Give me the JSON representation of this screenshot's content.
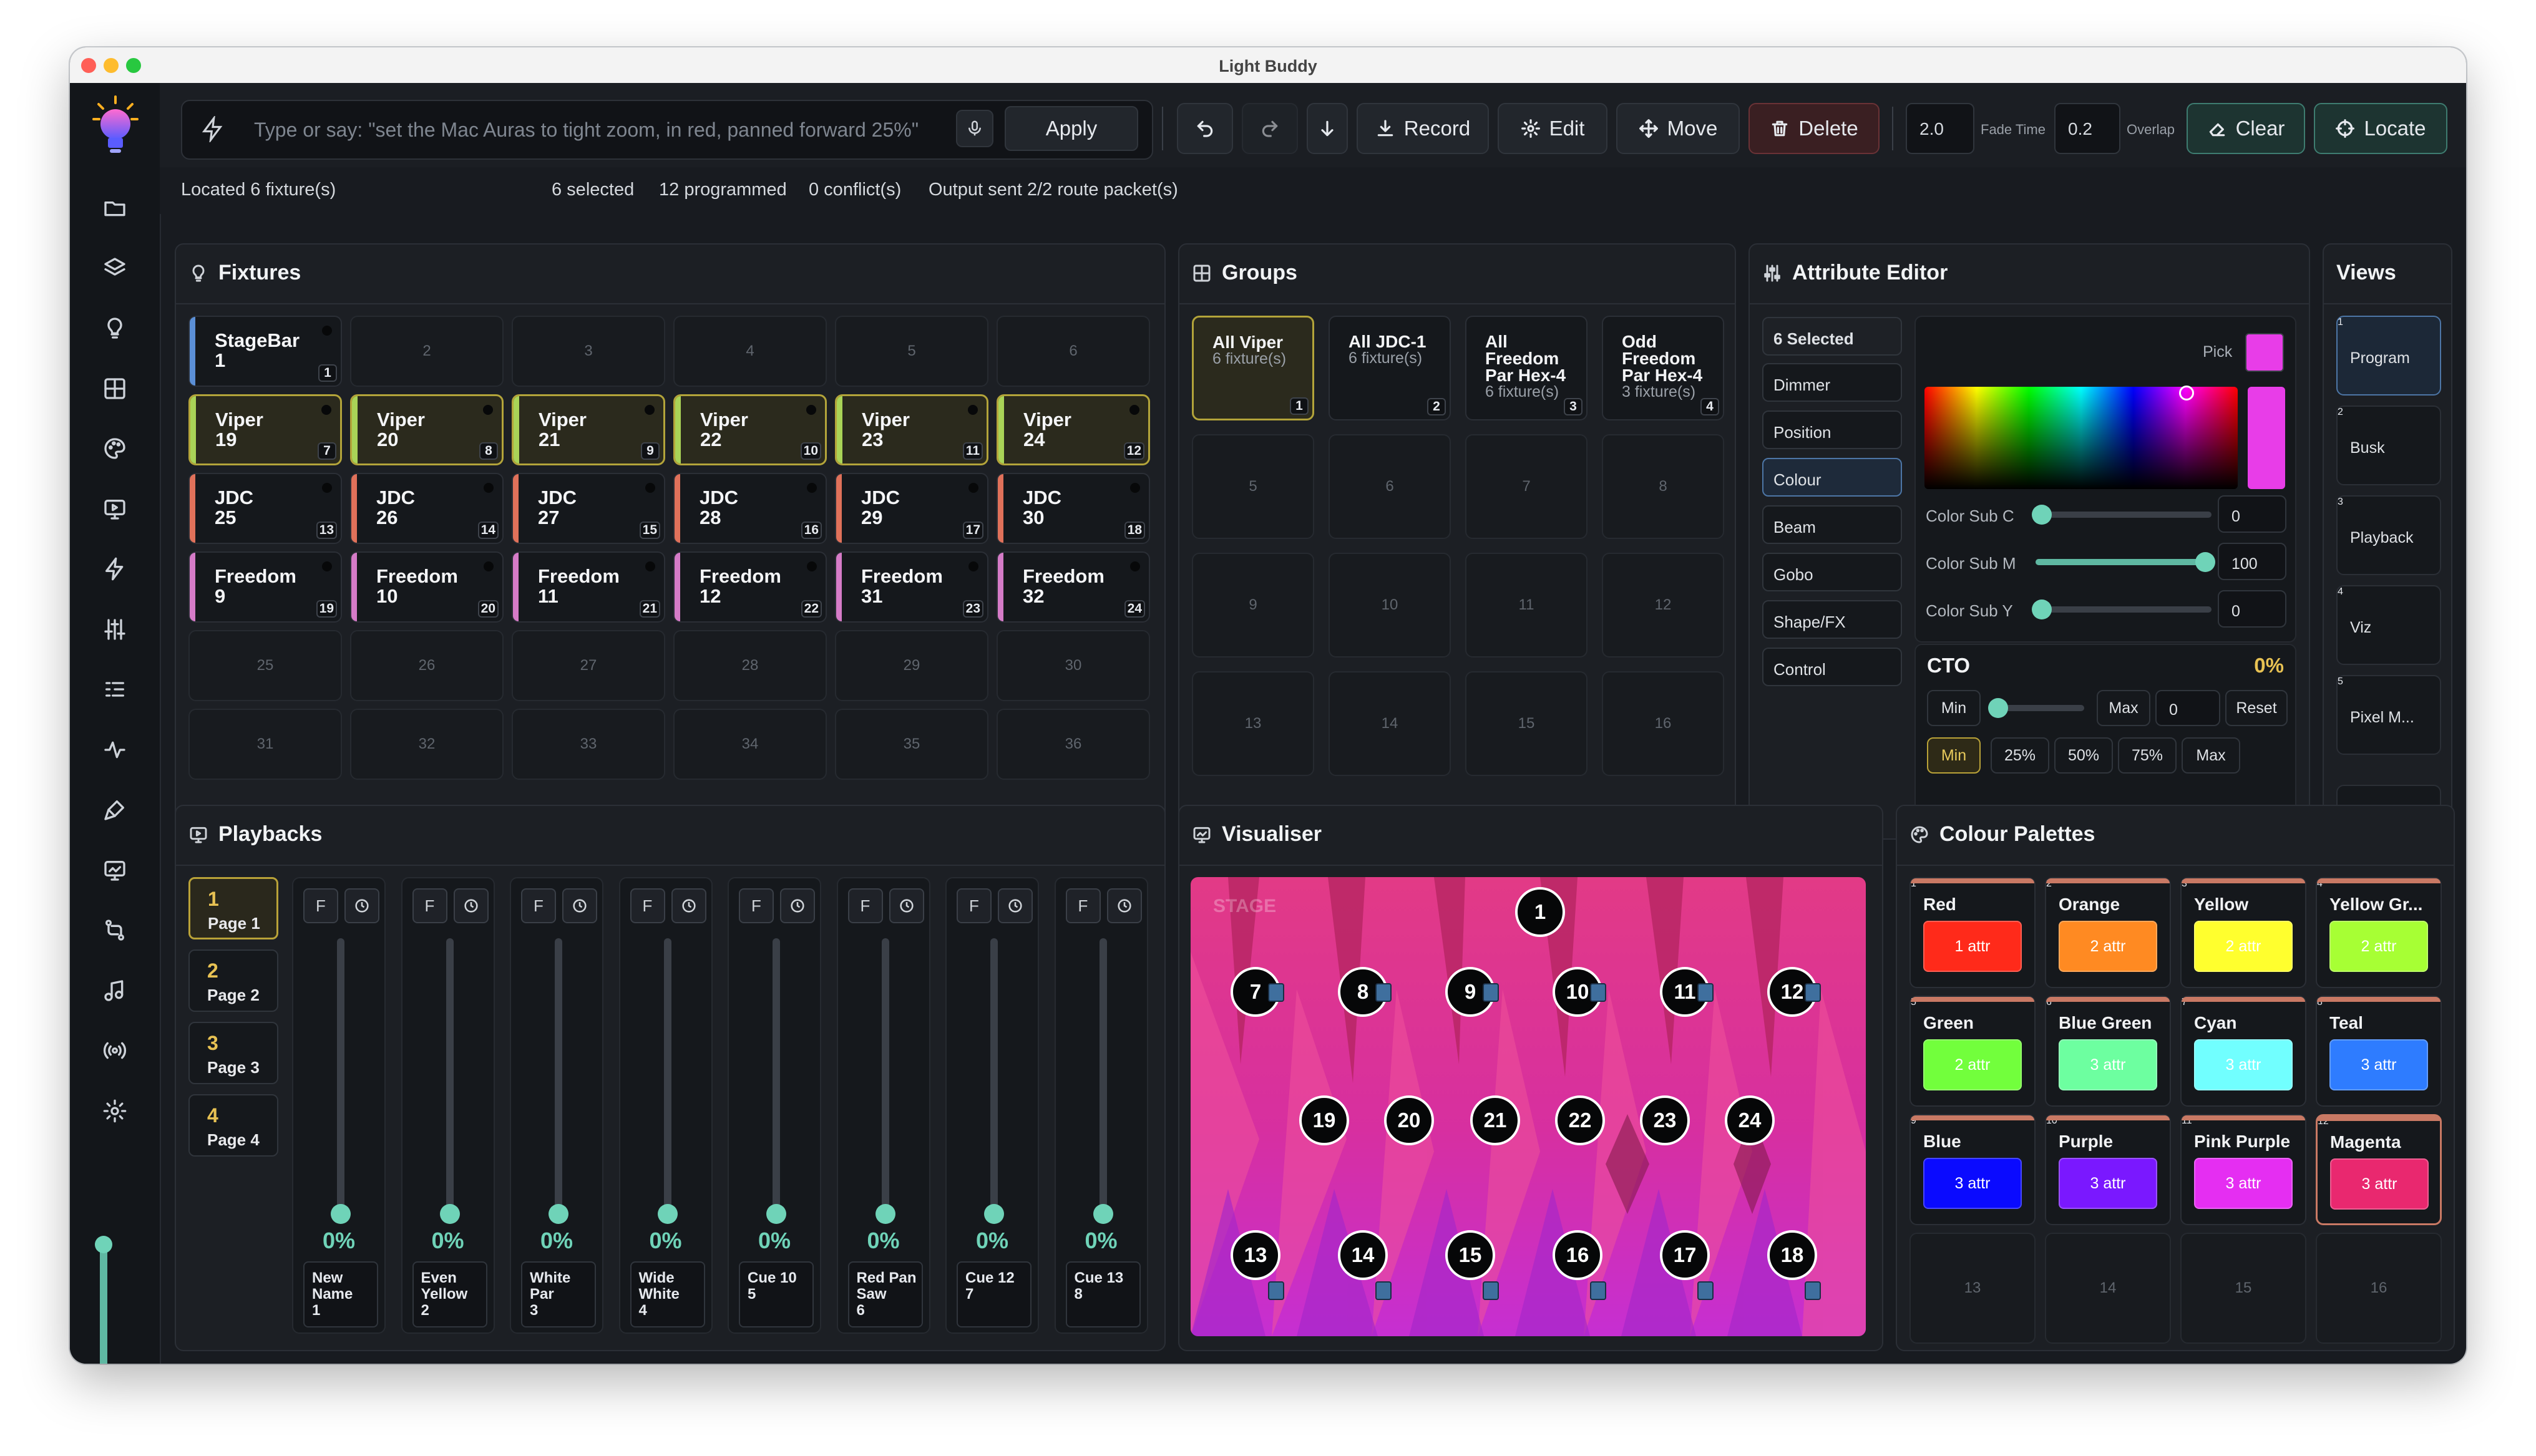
{
  "window": {
    "title": "Light Buddy"
  },
  "command": {
    "placeholder": "Type or say: \"set the Mac Auras to tight zoom, in red, panned forward 25%\"",
    "apply_label": "Apply",
    "record_label": "Record",
    "edit_label": "Edit",
    "move_label": "Move",
    "delete_label": "Delete",
    "fade_time_value": "2.0",
    "fade_time_label": "Fade Time",
    "overlap_value": "0.2",
    "overlap_label": "Overlap",
    "clear_label": "Clear",
    "locate_label": "Locate"
  },
  "status": {
    "located": "Located 6 fixture(s)",
    "selected": "6 selected",
    "programmed": "12 programmed",
    "conflicts": "0 conflict(s)",
    "output": "Output sent 2/2 route packet(s)"
  },
  "fixtures": {
    "title": "Fixtures",
    "tiles": [
      {
        "l1": "StageBar",
        "l2": "1",
        "idx": "1",
        "color": "#5b8fd6",
        "sel": false
      },
      {
        "empty": "2"
      },
      {
        "empty": "3"
      },
      {
        "empty": "4"
      },
      {
        "empty": "5"
      },
      {
        "empty": "6"
      },
      {
        "l1": "Viper",
        "l2": "19",
        "idx": "7",
        "color": "#a9d357",
        "sel": true
      },
      {
        "l1": "Viper",
        "l2": "20",
        "idx": "8",
        "color": "#a9d357",
        "sel": true
      },
      {
        "l1": "Viper",
        "l2": "21",
        "idx": "9",
        "color": "#a9d357",
        "sel": true
      },
      {
        "l1": "Viper",
        "l2": "22",
        "idx": "10",
        "color": "#a9d357",
        "sel": true
      },
      {
        "l1": "Viper",
        "l2": "23",
        "idx": "11",
        "color": "#a9d357",
        "sel": true
      },
      {
        "l1": "Viper",
        "l2": "24",
        "idx": "12",
        "color": "#a9d357",
        "sel": true
      },
      {
        "l1": "JDC",
        "l2": "25",
        "idx": "13",
        "color": "#e0715a",
        "sel": false
      },
      {
        "l1": "JDC",
        "l2": "26",
        "idx": "14",
        "color": "#e0715a",
        "sel": false
      },
      {
        "l1": "JDC",
        "l2": "27",
        "idx": "15",
        "color": "#e0715a",
        "sel": false
      },
      {
        "l1": "JDC",
        "l2": "28",
        "idx": "16",
        "color": "#e0715a",
        "sel": false
      },
      {
        "l1": "JDC",
        "l2": "29",
        "idx": "17",
        "color": "#e0715a",
        "sel": false
      },
      {
        "l1": "JDC",
        "l2": "30",
        "idx": "18",
        "color": "#e0715a",
        "sel": false
      },
      {
        "l1": "Freedom",
        "l2": "9",
        "idx": "19",
        "color": "#d57bc7",
        "sel": false
      },
      {
        "l1": "Freedom",
        "l2": "10",
        "idx": "20",
        "color": "#d57bc7",
        "sel": false
      },
      {
        "l1": "Freedom",
        "l2": "11",
        "idx": "21",
        "color": "#d57bc7",
        "sel": false
      },
      {
        "l1": "Freedom",
        "l2": "12",
        "idx": "22",
        "color": "#d57bc7",
        "sel": false
      },
      {
        "l1": "Freedom",
        "l2": "31",
        "idx": "23",
        "color": "#d57bc7",
        "sel": false
      },
      {
        "l1": "Freedom",
        "l2": "32",
        "idx": "24",
        "color": "#d57bc7",
        "sel": false
      },
      {
        "empty": "25"
      },
      {
        "empty": "26"
      },
      {
        "empty": "27"
      },
      {
        "empty": "28"
      },
      {
        "empty": "29"
      },
      {
        "empty": "30"
      },
      {
        "empty": "31"
      },
      {
        "empty": "32"
      },
      {
        "empty": "33"
      },
      {
        "empty": "34"
      },
      {
        "empty": "35"
      },
      {
        "empty": "36"
      }
    ]
  },
  "groups": {
    "title": "Groups",
    "tiles": [
      {
        "name": "All Viper",
        "count": "6 fixture(s)",
        "idx": "1",
        "sel": true
      },
      {
        "name": "All JDC-1",
        "count": "6 fixture(s)",
        "idx": "2",
        "sel": false
      },
      {
        "name": "All\nFreedom\nPar Hex-4",
        "count": "6 fixture(s)",
        "idx": "3",
        "sel": false
      },
      {
        "name": "Odd\nFreedom\nPar Hex-4",
        "count": "3 fixture(s)",
        "idx": "4",
        "sel": false
      },
      {
        "empty": "5"
      },
      {
        "empty": "6"
      },
      {
        "empty": "7"
      },
      {
        "empty": "8"
      },
      {
        "empty": "9"
      },
      {
        "empty": "10"
      },
      {
        "empty": "11"
      },
      {
        "empty": "12"
      },
      {
        "empty": "13"
      },
      {
        "empty": "14"
      },
      {
        "empty": "15"
      },
      {
        "empty": "16"
      }
    ]
  },
  "attribute_editor": {
    "title": "Attribute Editor",
    "selected_label": "6 Selected",
    "attributes": [
      "Dimmer",
      "Position",
      "Colour",
      "Beam",
      "Gobo",
      "Shape/FX",
      "Control"
    ],
    "active_attribute": "Colour",
    "pick_label": "Pick",
    "pick_color": "#e83de8",
    "sliders": [
      {
        "label": "Color Sub C",
        "value": "0",
        "frac": 0
      },
      {
        "label": "Color Sub M",
        "value": "100",
        "frac": 1
      },
      {
        "label": "Color Sub Y",
        "value": "0",
        "frac": 0
      }
    ],
    "cto": {
      "title": "CTO",
      "value": "0%",
      "min_label": "Min",
      "max_label": "Max",
      "max_value": "0",
      "reset_label": "Reset",
      "presets": [
        "Min",
        "25%",
        "50%",
        "75%",
        "Max"
      ],
      "active_preset": "Min"
    }
  },
  "views": {
    "title": "Views",
    "items": [
      {
        "name": "Program",
        "idx": "1",
        "sel": true
      },
      {
        "name": "Busk",
        "idx": "2",
        "sel": false
      },
      {
        "name": "Playback",
        "idx": "3",
        "sel": false
      },
      {
        "name": "Viz",
        "idx": "4",
        "sel": false
      },
      {
        "name": "Pixel M...",
        "idx": "5",
        "sel": false
      }
    ]
  },
  "playbacks": {
    "title": "Playbacks",
    "pages": [
      {
        "num": "1",
        "label": "Page 1",
        "sel": true
      },
      {
        "num": "2",
        "label": "Page 2",
        "sel": false
      },
      {
        "num": "3",
        "label": "Page 3",
        "sel": false
      },
      {
        "num": "4",
        "label": "Page 4",
        "sel": false
      }
    ],
    "flash_label": "F",
    "faders": [
      {
        "name": "New\nName",
        "idx": "1",
        "pct": "0%",
        "level": 0
      },
      {
        "name": "Even\nYellow",
        "idx": "2",
        "pct": "0%",
        "level": 0
      },
      {
        "name": "White\nPar",
        "idx": "3",
        "pct": "0%",
        "level": 0
      },
      {
        "name": "Wide\nWhite",
        "idx": "4",
        "pct": "0%",
        "level": 0
      },
      {
        "name": "Cue 10",
        "idx": "5",
        "pct": "0%",
        "level": 0
      },
      {
        "name": "Red Pan\nSaw",
        "idx": "6",
        "pct": "0%",
        "level": 0
      },
      {
        "name": "Cue 12",
        "idx": "7",
        "pct": "0%",
        "level": 0
      },
      {
        "name": "Cue 13",
        "idx": "8",
        "pct": "0%",
        "level": 0
      }
    ]
  },
  "visualiser": {
    "title": "Visualiser",
    "stage_label": "STAGE",
    "fixtures": [
      "1",
      "7",
      "8",
      "9",
      "10",
      "11",
      "12",
      "19",
      "20",
      "21",
      "22",
      "23",
      "24",
      "13",
      "14",
      "15",
      "16",
      "17",
      "18"
    ]
  },
  "palettes": {
    "title": "Colour Palettes",
    "items": [
      {
        "name": "Red",
        "attr": "1 attr",
        "color": "#ff2a1a",
        "idx": "1"
      },
      {
        "name": "Orange",
        "attr": "2 attr",
        "color": "#ff8a22",
        "idx": "2"
      },
      {
        "name": "Yellow",
        "attr": "2 attr",
        "color": "#ffff2e",
        "idx": "3"
      },
      {
        "name": "Yellow Gr...",
        "attr": "2 attr",
        "color": "#a7ff34",
        "idx": "4"
      },
      {
        "name": "Green",
        "attr": "2 attr",
        "color": "#72ff3c",
        "idx": "5"
      },
      {
        "name": "Blue Green",
        "attr": "3 attr",
        "color": "#6dffa0",
        "idx": "6"
      },
      {
        "name": "Cyan",
        "attr": "3 attr",
        "color": "#71ffff",
        "idx": "7"
      },
      {
        "name": "Teal",
        "attr": "3 attr",
        "color": "#2e7cff",
        "idx": "8"
      },
      {
        "name": "Blue",
        "attr": "3 attr",
        "color": "#0a0aff",
        "idx": "9"
      },
      {
        "name": "Purple",
        "attr": "3 attr",
        "color": "#7a18ff",
        "idx": "10"
      },
      {
        "name": "Pink Purple",
        "attr": "3 attr",
        "color": "#e52ef2",
        "idx": "11"
      },
      {
        "name": "Magenta",
        "attr": "3 attr",
        "color": "#e9286f",
        "idx": "12",
        "sel": true
      },
      {
        "empty": "13"
      },
      {
        "empty": "14"
      },
      {
        "empty": "15"
      },
      {
        "empty": "16"
      }
    ]
  },
  "icons": {
    "rail": [
      "folder-icon",
      "layers-icon",
      "bulb-icon",
      "grid-icon",
      "palette-icon",
      "monitor-icon",
      "bolt-icon",
      "sliders-icon",
      "list-icon",
      "pulse-icon",
      "brush-icon",
      "display-icon",
      "route-icon",
      "music-icon",
      "broadcast-icon",
      "gear-icon"
    ]
  }
}
